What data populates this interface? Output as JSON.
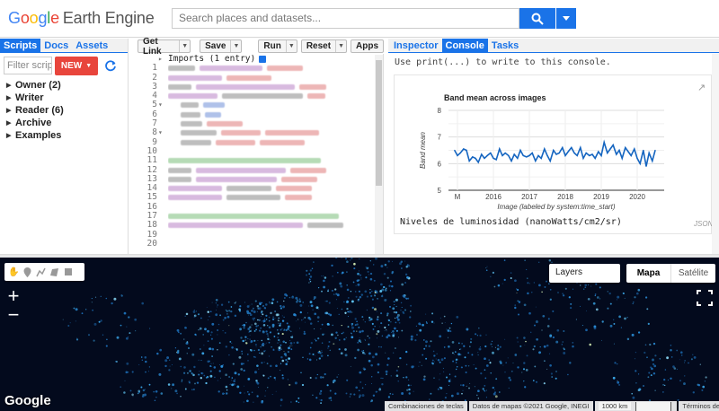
{
  "header": {
    "logo_google": [
      "G",
      "o",
      "o",
      "g",
      "l",
      "e"
    ],
    "logo_suffix": "Earth Engine",
    "search_placeholder": "Search places and datasets..."
  },
  "left_panel": {
    "tabs": [
      {
        "label": "Scripts",
        "active": true
      },
      {
        "label": "Docs",
        "active": false
      },
      {
        "label": "Assets",
        "active": false
      }
    ],
    "filter_placeholder": "Filter scripts",
    "new_label": "NEW",
    "tree": [
      {
        "label": "Owner (2)"
      },
      {
        "label": "Writer"
      },
      {
        "label": "Reader (6)"
      },
      {
        "label": "Archive"
      },
      {
        "label": "Examples"
      }
    ]
  },
  "editor": {
    "toolbar": {
      "get_link": "Get Link",
      "save": "Save",
      "run": "Run",
      "reset": "Reset",
      "apps": "Apps"
    },
    "imports_label": "Imports (1 entry)",
    "line_numbers": [
      "1",
      "2",
      "3",
      "4",
      "5",
      "6",
      "7",
      "8",
      "9",
      "10",
      "11",
      "12",
      "13",
      "14",
      "15",
      "16",
      "17",
      "18",
      "19",
      "20"
    ],
    "folded_lines": [
      "5",
      "8"
    ]
  },
  "right_panel": {
    "tabs": [
      {
        "label": "Inspector",
        "active": false
      },
      {
        "label": "Console",
        "active": true
      },
      {
        "label": "Tasks",
        "active": false
      }
    ],
    "console_hint": "Use print(...) to write to this console.",
    "chart_caption": "Niveles de luminosidad (nanoWatts/cm2/sr)",
    "json_label": "JSON",
    "colors": {
      "accent": "#1a73e8",
      "series": "#1565c0"
    }
  },
  "chart_data": {
    "type": "line",
    "title": "Band mean across images",
    "xlabel": "Image (labeled by system:time_start)",
    "ylabel": "Band mean",
    "xlim": [
      2014.75,
      2020.75
    ],
    "ylim": [
      5,
      8
    ],
    "yticks": [
      "8",
      "7",
      "6",
      "5"
    ],
    "xticks": [
      "M",
      "2016",
      "2017",
      "2018",
      "2019",
      "2020"
    ],
    "series": [
      {
        "values": [
          [
            2014.92,
            6.5
          ],
          [
            2015.0,
            6.3
          ],
          [
            2015.08,
            6.4
          ],
          [
            2015.17,
            6.55
          ],
          [
            2015.25,
            6.5
          ],
          [
            2015.33,
            6.1
          ],
          [
            2015.42,
            6.25
          ],
          [
            2015.5,
            6.2
          ],
          [
            2015.58,
            6.05
          ],
          [
            2015.67,
            6.35
          ],
          [
            2015.75,
            6.2
          ],
          [
            2015.83,
            6.3
          ],
          [
            2015.92,
            6.4
          ],
          [
            2016.0,
            6.2
          ],
          [
            2016.08,
            6.15
          ],
          [
            2016.17,
            6.55
          ],
          [
            2016.25,
            6.3
          ],
          [
            2016.33,
            6.4
          ],
          [
            2016.42,
            6.3
          ],
          [
            2016.5,
            6.1
          ],
          [
            2016.58,
            6.35
          ],
          [
            2016.67,
            6.2
          ],
          [
            2016.75,
            6.5
          ],
          [
            2016.83,
            6.3
          ],
          [
            2016.92,
            6.25
          ],
          [
            2017.0,
            6.3
          ],
          [
            2017.08,
            6.4
          ],
          [
            2017.17,
            6.1
          ],
          [
            2017.25,
            6.3
          ],
          [
            2017.33,
            6.2
          ],
          [
            2017.42,
            6.55
          ],
          [
            2017.5,
            6.3
          ],
          [
            2017.58,
            6.1
          ],
          [
            2017.67,
            6.5
          ],
          [
            2017.75,
            6.35
          ],
          [
            2017.83,
            6.4
          ],
          [
            2017.92,
            6.6
          ],
          [
            2018.0,
            6.3
          ],
          [
            2018.08,
            6.45
          ],
          [
            2018.17,
            6.6
          ],
          [
            2018.25,
            6.4
          ],
          [
            2018.33,
            6.3
          ],
          [
            2018.42,
            6.6
          ],
          [
            2018.5,
            6.2
          ],
          [
            2018.58,
            6.4
          ],
          [
            2018.67,
            6.3
          ],
          [
            2018.75,
            6.35
          ],
          [
            2018.83,
            6.2
          ],
          [
            2018.92,
            6.45
          ],
          [
            2019.0,
            6.3
          ],
          [
            2019.08,
            6.8
          ],
          [
            2019.17,
            6.4
          ],
          [
            2019.25,
            6.55
          ],
          [
            2019.33,
            6.7
          ],
          [
            2019.42,
            6.35
          ],
          [
            2019.5,
            6.5
          ],
          [
            2019.58,
            6.2
          ],
          [
            2019.67,
            6.6
          ],
          [
            2019.75,
            6.45
          ],
          [
            2019.83,
            6.3
          ],
          [
            2019.92,
            6.55
          ],
          [
            2020.0,
            6.2
          ],
          [
            2020.08,
            6.0
          ],
          [
            2020.17,
            6.5
          ],
          [
            2020.25,
            5.9
          ],
          [
            2020.33,
            6.4
          ],
          [
            2020.42,
            6.1
          ],
          [
            2020.5,
            6.5
          ]
        ]
      }
    ],
    "grid": true,
    "legend": "none"
  },
  "map": {
    "layers_label": "Layers",
    "map_type": "Mapa",
    "satellite": "Satélite",
    "google_label": "Google",
    "attribution": {
      "shortcuts": "Combinaciones de teclas",
      "data": "Datos de mapas ©2021 Google, INEGI",
      "scale": "1000 km",
      "terms": "Términos de uso"
    },
    "zoom_in": "+",
    "zoom_out": "−"
  }
}
